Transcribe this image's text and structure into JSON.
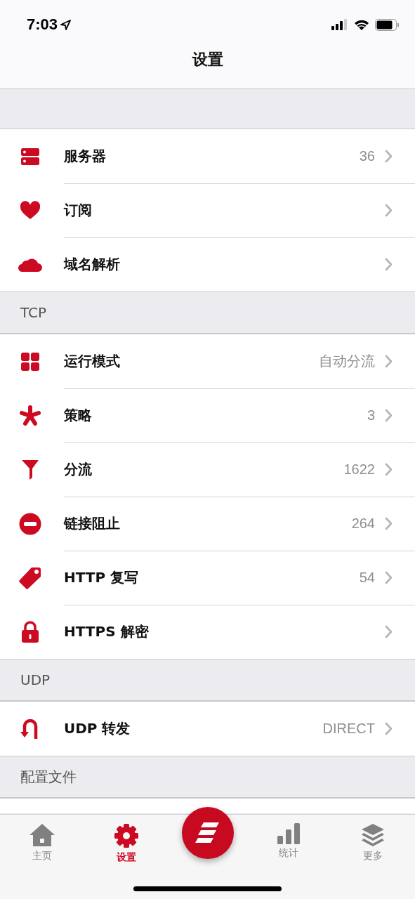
{
  "status_bar": {
    "time": "7:03"
  },
  "title": "设置",
  "sections": [
    {
      "rows": [
        {
          "title": "服务器",
          "value": "36"
        },
        {
          "title": "订阅"
        },
        {
          "title": "域名解析"
        }
      ]
    },
    {
      "header": "TCP",
      "rows": [
        {
          "title": "运行模式",
          "value": "自动分流"
        },
        {
          "title": "策略",
          "value": "3"
        },
        {
          "title": "分流",
          "value": "1622"
        },
        {
          "title": "链接阻止",
          "value": "264"
        },
        {
          "title": "HTTP 复写",
          "value": "54"
        },
        {
          "title": "HTTPS 解密"
        }
      ]
    },
    {
      "header": "UDP",
      "rows": [
        {
          "title": "UDP 转发",
          "value": "DIRECT"
        }
      ]
    },
    {
      "header": "配置文件"
    }
  ],
  "tabs": [
    {
      "label": "主页",
      "selected": false
    },
    {
      "label": "设置",
      "selected": true
    },
    {
      "label": "统计",
      "selected": false
    },
    {
      "label": "更多",
      "selected": false
    }
  ]
}
